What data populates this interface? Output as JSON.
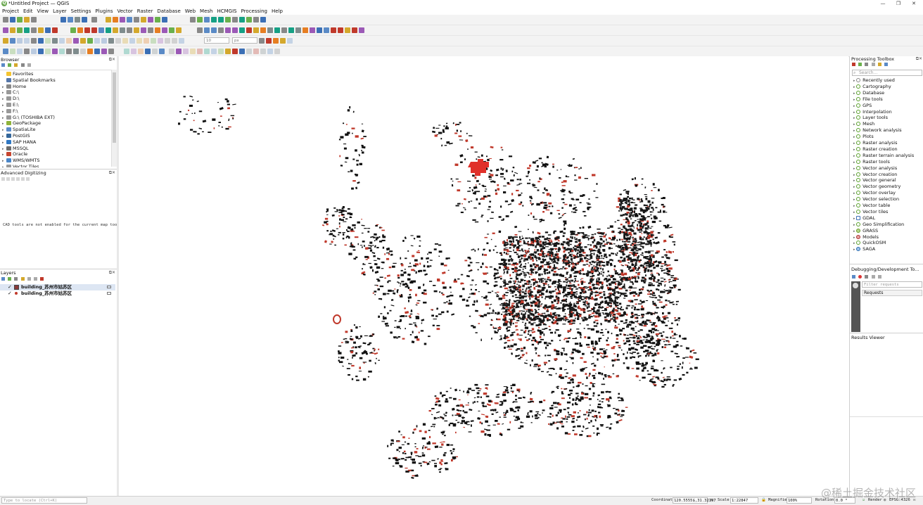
{
  "window": {
    "title": "*Untitled Project — QGIS",
    "logo": "Q",
    "controls": [
      "—",
      "❐",
      "✕"
    ]
  },
  "menu": [
    "Project",
    "Edit",
    "View",
    "Layer",
    "Settings",
    "Plugins",
    "Vector",
    "Raster",
    "Database",
    "Web",
    "Mesh",
    "HCMGIS",
    "Processing",
    "Help"
  ],
  "toolbar": {
    "scale_field": "10",
    "unit_field": "px"
  },
  "browser": {
    "title": "Browser",
    "items": [
      {
        "label": "Favorites",
        "icon": "star-icon",
        "color": "#f4c430"
      },
      {
        "label": "Spatial Bookmarks",
        "icon": "bookmark-icon",
        "color": "#5577aa"
      },
      {
        "label": "Home",
        "icon": "home-icon",
        "color": "#888888"
      },
      {
        "label": "C:\\",
        "icon": "drive-icon",
        "color": "#999999"
      },
      {
        "label": "D:\\",
        "icon": "drive-icon",
        "color": "#999999"
      },
      {
        "label": "E:\\",
        "icon": "drive-icon",
        "color": "#999999"
      },
      {
        "label": "F:\\",
        "icon": "drive-icon",
        "color": "#999999"
      },
      {
        "label": "G:\\ (TOSHIBA EXT)",
        "icon": "drive-icon",
        "color": "#999999"
      },
      {
        "label": "GeoPackage",
        "icon": "geopackage-icon",
        "color": "#8fb33a"
      },
      {
        "label": "SpatiaLite",
        "icon": "spatialite-icon",
        "color": "#5b8bc9"
      },
      {
        "label": "PostGIS",
        "icon": "postgis-icon",
        "color": "#33669a"
      },
      {
        "label": "SAP HANA",
        "icon": "saphana-icon",
        "color": "#2f78c4"
      },
      {
        "label": "MSSQL",
        "icon": "mssql-icon",
        "color": "#6d6d6d"
      },
      {
        "label": "Oracle",
        "icon": "oracle-icon",
        "color": "#c7452f"
      },
      {
        "label": "WMS/WMTS",
        "icon": "wms-icon",
        "color": "#4a86c8"
      },
      {
        "label": "Vector Tiles",
        "icon": "vectortiles-icon",
        "color": "#999999"
      }
    ]
  },
  "digitizing": {
    "title": "Advanced Digitizing",
    "message": "CAD tools are not enabled for the current map tool"
  },
  "layers": {
    "title": "Layers",
    "items": [
      {
        "label": "building_苏州市姑苏区",
        "checked": "✓",
        "swatch": "#8a3a3a",
        "type": "polygon"
      },
      {
        "label": "building_苏州市姑苏区",
        "checked": "✓",
        "swatch": "#c0392b",
        "type": "point"
      }
    ]
  },
  "toolbox": {
    "title": "Processing Toolbox",
    "search_placeholder": "Search...",
    "items": [
      "Recently used",
      "Cartography",
      "Database",
      "File tools",
      "GPS",
      "Interpolation",
      "Layer tools",
      "Mesh",
      "Network analysis",
      "Plots",
      "Raster analysis",
      "Raster creation",
      "Raster terrain analysis",
      "Raster tools",
      "Vector analysis",
      "Vector creation",
      "Vector general",
      "Vector geometry",
      "Vector overlay",
      "Vector selection",
      "Vector table",
      "Vector tiles",
      "GDAL",
      "Geo Simplification",
      "GRASS",
      "Models",
      "QuickOSM",
      "SAGA"
    ]
  },
  "debugging": {
    "title": "Debugging/Development To...",
    "filter_placeholder": "Filter requests",
    "tab": "Requests"
  },
  "results": {
    "title": "Results Viewer"
  },
  "status": {
    "locator_placeholder": "Type to locate (Ctrl+K)",
    "coordinate_label": "Coordinate",
    "coordinate": "120.5555$,31.32197",
    "scale_label": "Scale",
    "scale": "1:22847",
    "magnifier_label": "Magnifier",
    "magnifier": "100%",
    "rotation_label": "Rotation",
    "rotation": "0.0 °",
    "render_label": "Render",
    "crs": "EPSG:4326"
  },
  "watermark": "@稀土掘金技术社区",
  "colors": {
    "building_fill": "#111111",
    "building_red": "#c0392b",
    "highlight": "#e0302a"
  }
}
